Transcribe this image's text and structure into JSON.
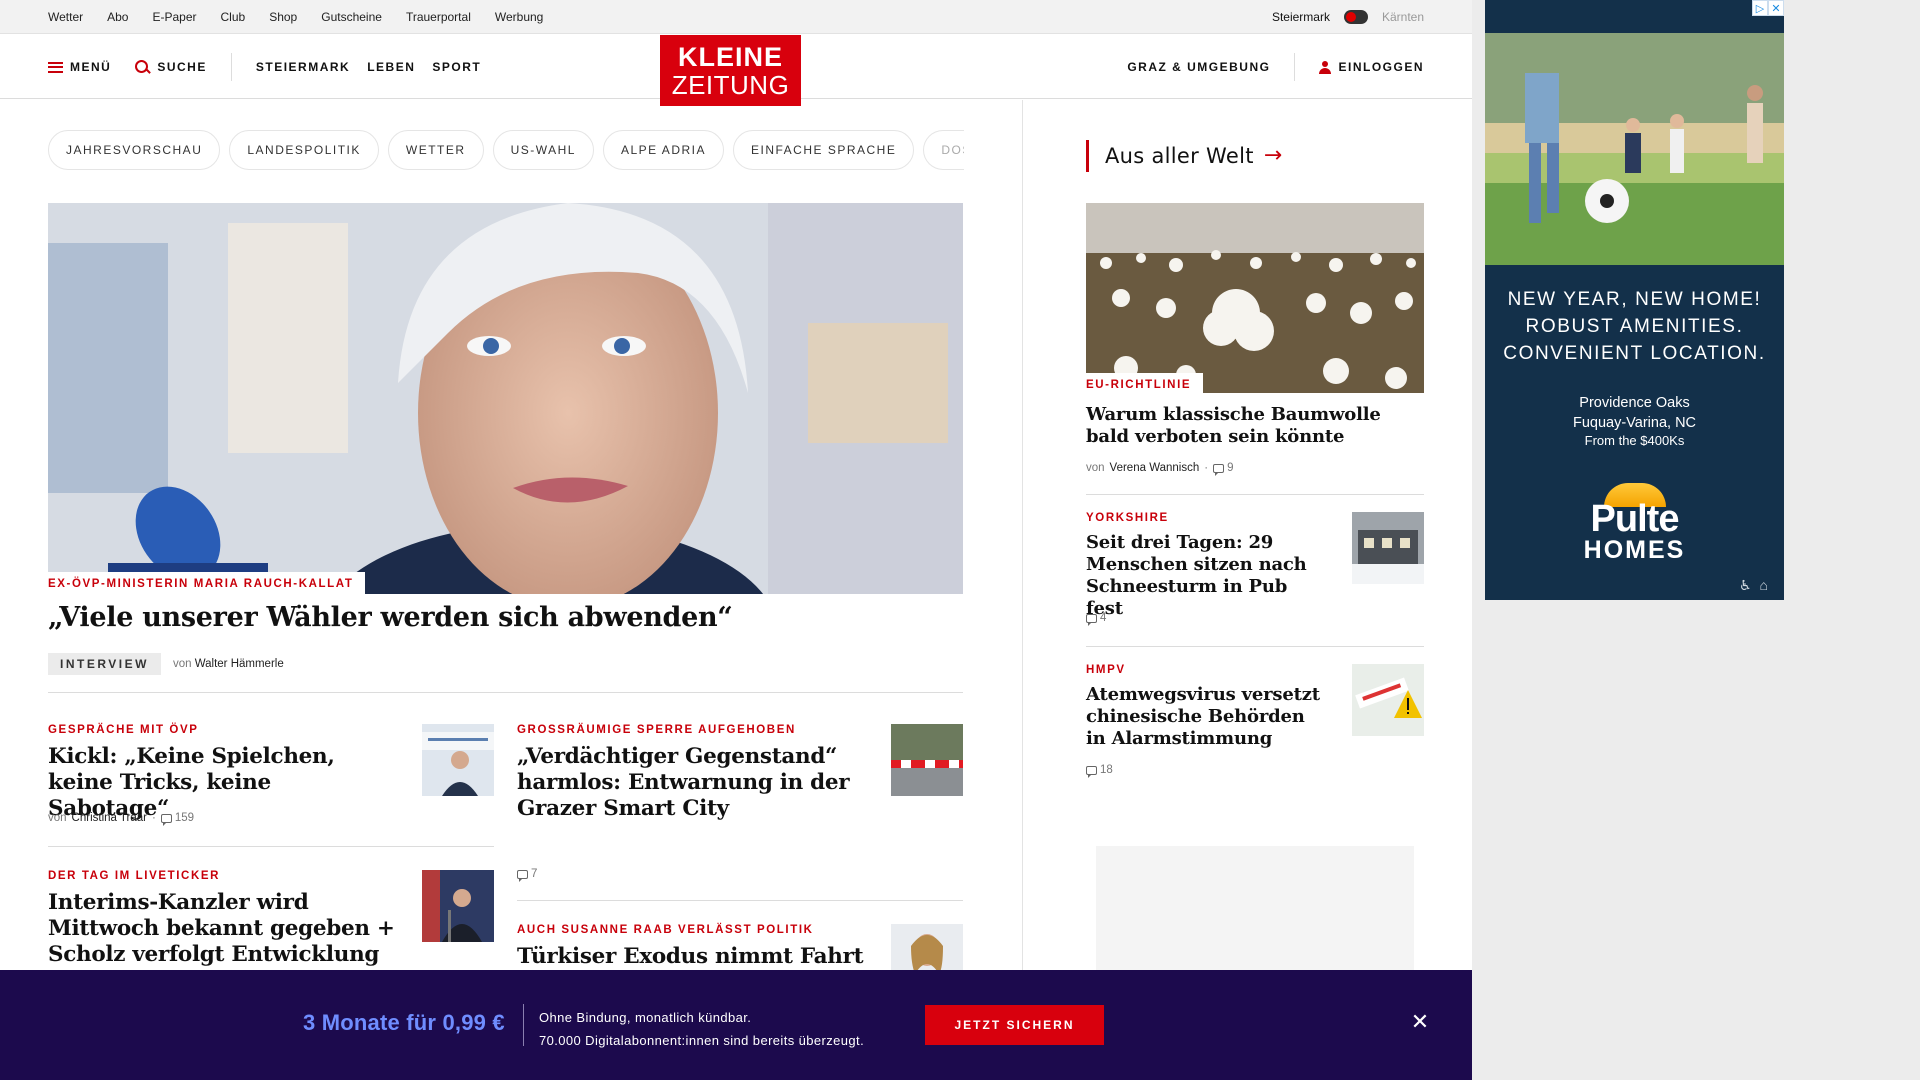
{
  "topbar": {
    "links": [
      "Wetter",
      "Abo",
      "E-Paper",
      "Club",
      "Shop",
      "Gutscheine",
      "Trauerportal",
      "Werbung"
    ],
    "region_left": "Steiermark",
    "region_right": "Kärnten"
  },
  "header": {
    "menu_label": "MENÜ",
    "search_label": "SUCHE",
    "nav": [
      "STEIERMARK",
      "LEBEN",
      "SPORT"
    ],
    "logo_line1": "KLEINE",
    "logo_line2": "ZEITUNG",
    "region_link": "GRAZ & UMGEBUNG",
    "login_label": "EINLOGGEN",
    "accent_color": "#d8000d"
  },
  "tags": [
    "JAHRESVORSCHAU",
    "LANDESPOLITIK",
    "WETTER",
    "US-WAHL",
    "ALPE ADRIA",
    "EINFACHE SPRACHE",
    "DOS"
  ],
  "hero": {
    "kicker": "EX-ÖVP-MINISTERIN MARIA RAUCH-KALLAT",
    "title": "„Viele unserer Wähler werden sich abwenden“",
    "badge": "INTERVIEW",
    "by": "von",
    "author": "Walter Hämmerle"
  },
  "articles": [
    {
      "kicker": "GESPRÄCHE MIT ÖVP",
      "title": "Kickl: „Keine Spielchen, keine Tricks, keine Sabotage“",
      "by": "von",
      "author": "Christina Traar",
      "dot": "·",
      "comments": "159"
    },
    {
      "kicker": "GROSSRÄUMIGE SPERRE AUFGEHOBEN",
      "title": "„Verdächtiger Gegenstand“ harmlos: Entwarnung in der Grazer Smart City",
      "comments": "7"
    },
    {
      "kicker": "DER TAG IM LIVETICKER",
      "title": "Interims-Kanzler wird Mittwoch bekannt gegeben + Scholz verfolgt Entwicklung in"
    },
    {
      "kicker": "AUCH SUSANNE RAAB VERLÄSST POLITIK",
      "title": "Türkiser Exodus nimmt Fahrt auf"
    }
  ],
  "sidebar": {
    "heading": "Aus aller Welt",
    "lead": {
      "kicker": "EU-RICHTLINIE",
      "title": "Warum klassische Baumwolle bald verboten sein könnte",
      "by": "von",
      "author": "Verena Wannisch",
      "dot": "·",
      "comments": "9"
    },
    "items": [
      {
        "kicker": "YORKSHIRE",
        "title": "Seit drei Tagen: 29 Menschen sitzen nach Schneesturm in Pub fest",
        "comments": "4"
      },
      {
        "kicker": "HMPV",
        "title": "Atemwegsvirus versetzt chinesische Behörden in Alarmstimmung",
        "comments": "18"
      }
    ]
  },
  "ad": {
    "headline": [
      "NEW YEAR, NEW HOME!",
      "ROBUST AMENITIES.",
      "CONVENIENT LOCATION."
    ],
    "community": "Providence Oaks",
    "location": "Fuquay-Varina, NC",
    "price": "From the $400Ks",
    "brand_line1": "Pulte",
    "brand_line2": "HOMES"
  },
  "banner": {
    "price": "3 Monate für 0,99 €",
    "line1": "Ohne Bindung, monatlich kündbar.",
    "line2": "70.000 Digitalabonnent:innen sind bereits überzeugt.",
    "cta": "JETZT SICHERN"
  }
}
